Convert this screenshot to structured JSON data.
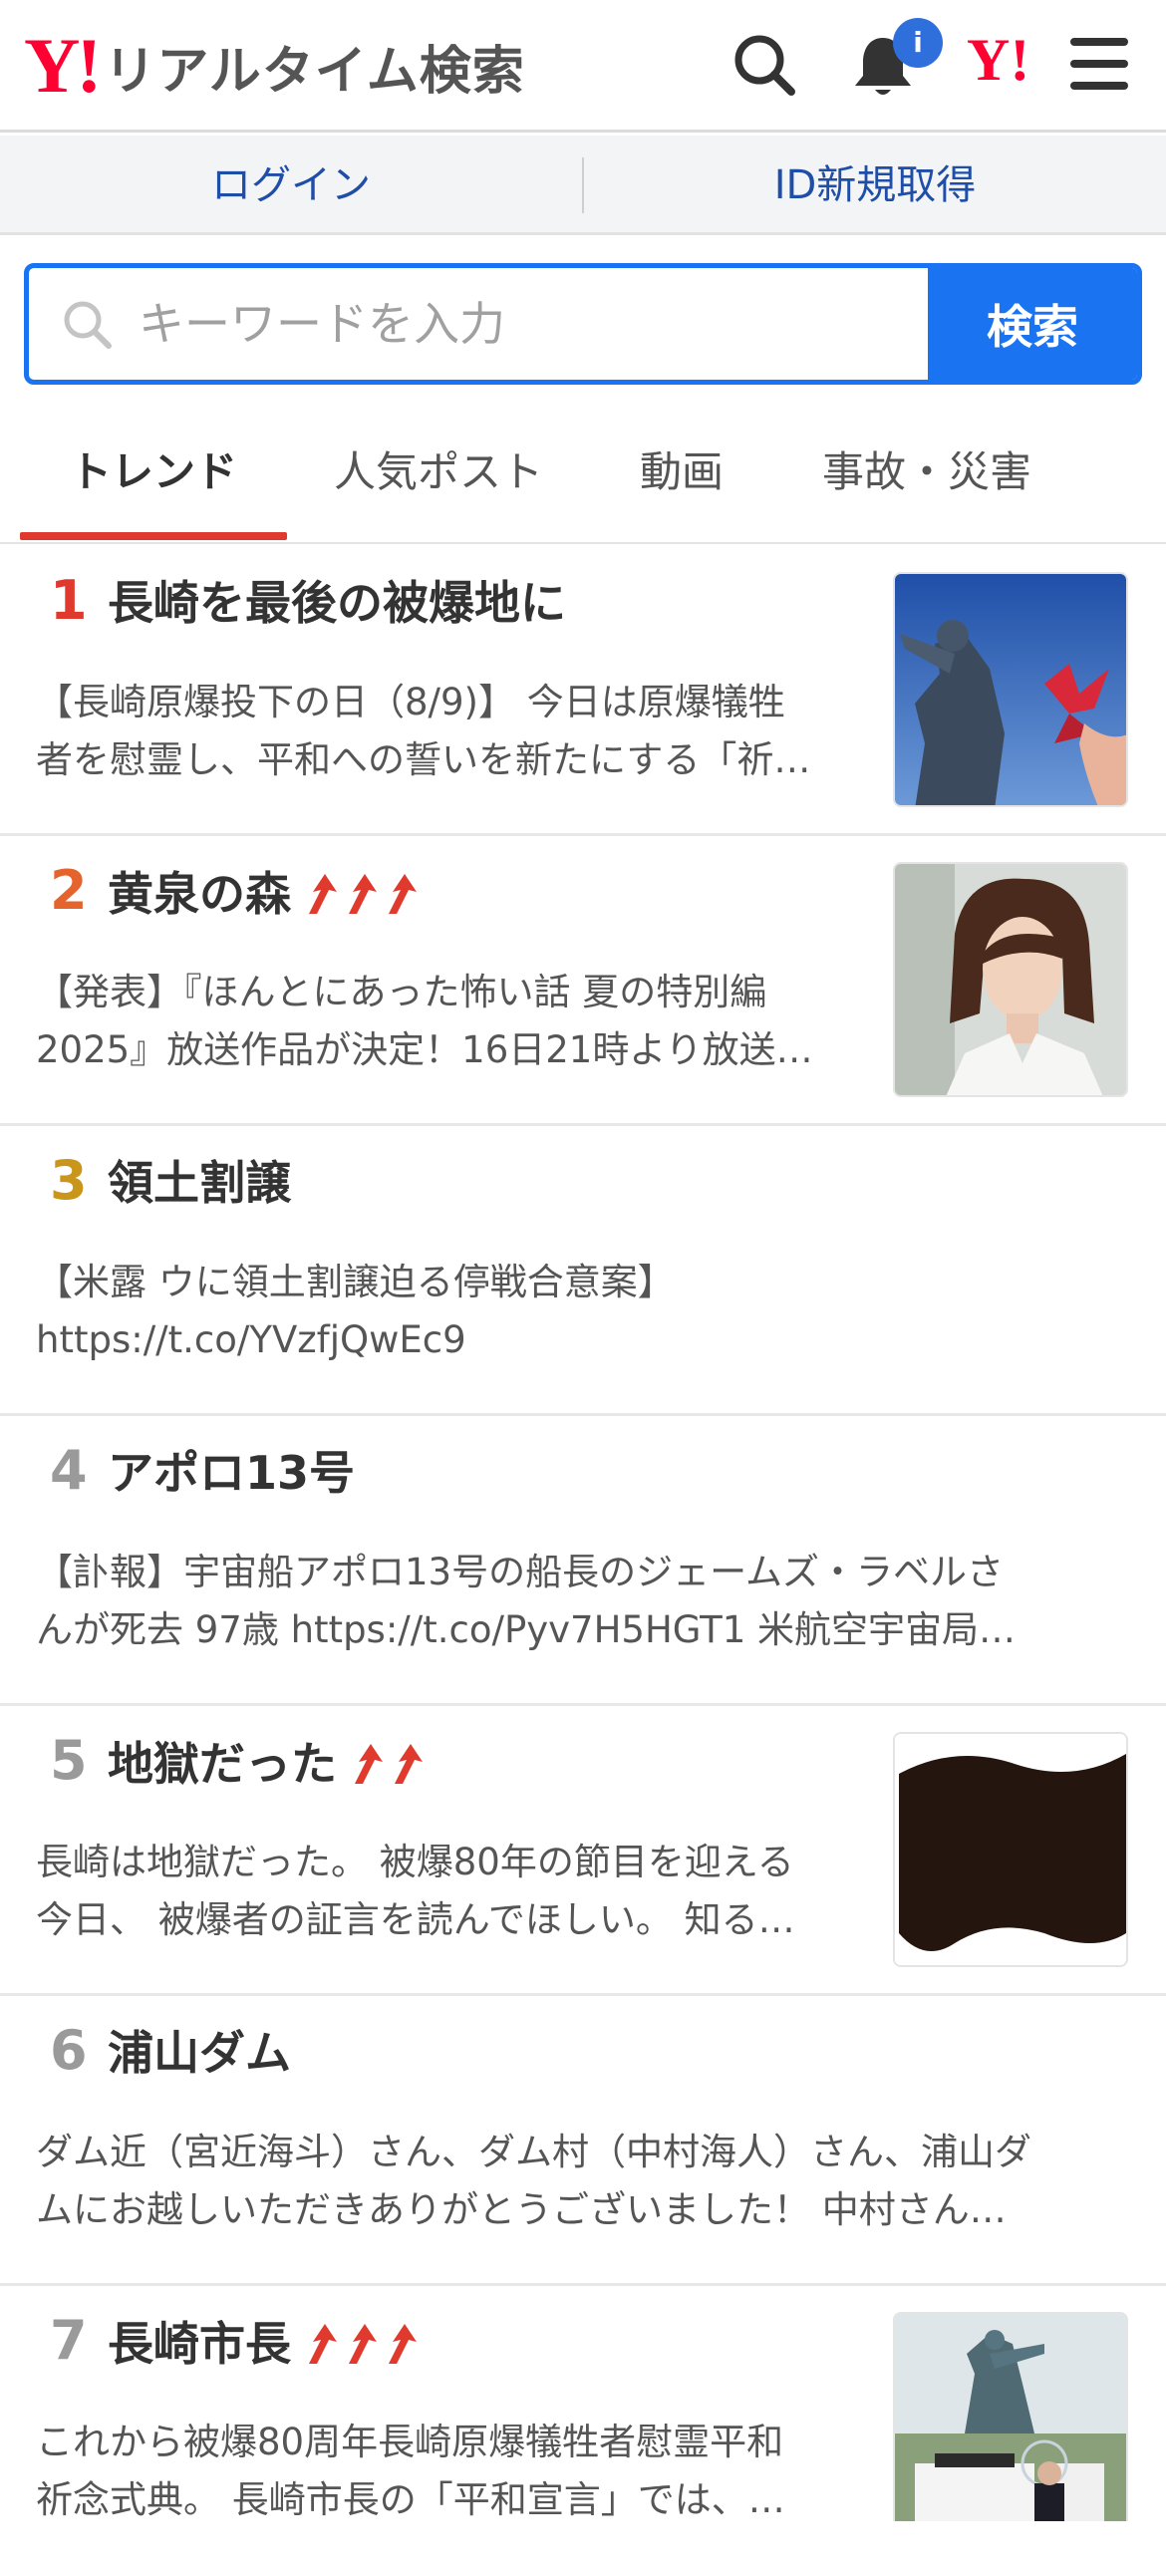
{
  "header": {
    "logo_mark": "Y!",
    "logo_text": "リアルタイム検索",
    "notification_badge": "i",
    "yahoo_mark": "Y!"
  },
  "login_bar": {
    "login_label": "ログイン",
    "register_label": "ID新規取得"
  },
  "search": {
    "placeholder": "キーワードを入力",
    "value": "",
    "button_label": "検索"
  },
  "tabs": [
    {
      "label": "トレンド",
      "active": true
    },
    {
      "label": "人気ポスト",
      "active": false
    },
    {
      "label": "動画",
      "active": false
    },
    {
      "label": "事故・災害",
      "active": false
    }
  ],
  "colors": {
    "brand_red": "#ff0033",
    "search_blue": "#1a73f0",
    "rank_1": "#e03a2f",
    "rank_2": "#e5632c",
    "rank_3": "#c9961b",
    "rank_other": "#9a9a9a",
    "arrow_red": "#e03a2f"
  },
  "trends": [
    {
      "rank": "1",
      "title": "長崎を最後の被爆地に",
      "rising": 0,
      "desc_line1": "【長崎原爆投下の日（8/9)】 今日は原爆犠牲",
      "desc_line2": "者を慰霊し、平和への誓いを新たにする「祈…",
      "thumbnail": "peace-statue-paper-crane"
    },
    {
      "rank": "2",
      "title": "黄泉の森",
      "rising": 3,
      "desc_line1": "【発表】『ほんとにあった怖い話 夏の特別編",
      "desc_line2": "2025』放送作品が決定！16日21時より放送…",
      "thumbnail": "actress-portrait"
    },
    {
      "rank": "3",
      "title": "領土割譲",
      "rising": 0,
      "desc_line1": "【米露 ウに領土割譲迫る停戦合意案】",
      "desc_line2": "https://t.co/YVzfjQwEc9",
      "thumbnail": ""
    },
    {
      "rank": "4",
      "title": "アポロ13号",
      "rising": 0,
      "desc_line1": "【訃報】宇宙船アポロ13号の船長のジェームズ・ラベルさ",
      "desc_line2": "んが死去 97歳 https://t.co/Pyv7H5HGT1 米航空宇宙局…",
      "thumbnail": ""
    },
    {
      "rank": "5",
      "title": "地獄だった",
      "rising": 2,
      "desc_line1": "長崎は地獄だった。 被爆80年の節目を迎える",
      "desc_line2": "今日、 被爆者の証言を読んでほしい。 知る…",
      "thumbnail": "dark-brush-image"
    },
    {
      "rank": "6",
      "title": "浦山ダム",
      "rising": 0,
      "desc_line1": "ダム近（宮近海斗）さん、ダム村（中村海人）さん、浦山ダ",
      "desc_line2": "ムにお越しいただきありがとうございました！ 中村さん…",
      "thumbnail": ""
    },
    {
      "rank": "7",
      "title": "長崎市長",
      "rising": 3,
      "desc_line1": "これから被爆80周年長崎原爆犠牲者慰霊平和",
      "desc_line2": "祈念式典。 長崎市長の「平和宣言」では、…",
      "thumbnail": "peace-park-ceremony"
    }
  ]
}
